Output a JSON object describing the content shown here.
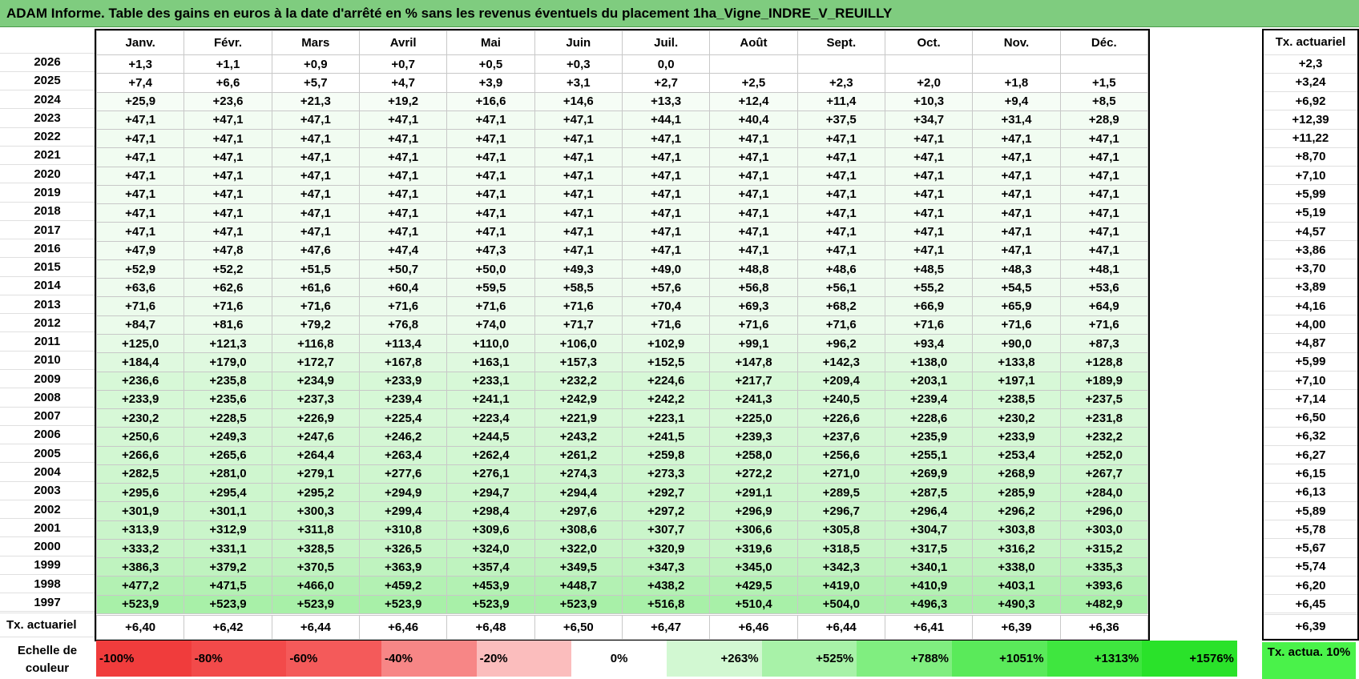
{
  "title": "ADAM Informe. Table des gains en euros à la date d'arrêté en % sans les revenus éventuels du placement 1ha_Vigne_INDRE_V_REUILLY",
  "months": [
    "Janv.",
    "Févr.",
    "Mars",
    "Avril",
    "Mai",
    "Juin",
    "Juil.",
    "Août",
    "Sept.",
    "Oct.",
    "Nov.",
    "Déc."
  ],
  "actuarial_header": "Tx. actuariel",
  "rows": [
    {
      "year": "2026",
      "values": [
        "+1,3",
        "+1,1",
        "+0,9",
        "+0,7",
        "+0,5",
        "+0,3",
        "0,0",
        "",
        "",
        "",
        "",
        ""
      ],
      "rate": "+2,3",
      "color": "#ffffff"
    },
    {
      "year": "2025",
      "values": [
        "+7,4",
        "+6,6",
        "+5,7",
        "+4,7",
        "+3,9",
        "+3,1",
        "+2,7",
        "+2,5",
        "+2,3",
        "+2,0",
        "+1,8",
        "+1,5"
      ],
      "rate": "+3,24",
      "color": "#ffffff"
    },
    {
      "year": "2024",
      "values": [
        "+25,9",
        "+23,6",
        "+21,3",
        "+19,2",
        "+16,6",
        "+14,6",
        "+13,3",
        "+12,4",
        "+11,4",
        "+10,3",
        "+9,4",
        "+8,5"
      ],
      "rate": "+6,92",
      "color": "#f6fdf6"
    },
    {
      "year": "2023",
      "values": [
        "+47,1",
        "+47,1",
        "+47,1",
        "+47,1",
        "+47,1",
        "+47,1",
        "+44,1",
        "+40,4",
        "+37,5",
        "+34,7",
        "+31,4",
        "+28,9"
      ],
      "rate": "+12,39",
      "color": "#f2fcf2"
    },
    {
      "year": "2022",
      "values": [
        "+47,1",
        "+47,1",
        "+47,1",
        "+47,1",
        "+47,1",
        "+47,1",
        "+47,1",
        "+47,1",
        "+47,1",
        "+47,1",
        "+47,1",
        "+47,1"
      ],
      "rate": "+11,22",
      "color": "#f1fcf1"
    },
    {
      "year": "2021",
      "values": [
        "+47,1",
        "+47,1",
        "+47,1",
        "+47,1",
        "+47,1",
        "+47,1",
        "+47,1",
        "+47,1",
        "+47,1",
        "+47,1",
        "+47,1",
        "+47,1"
      ],
      "rate": "+8,70",
      "color": "#f1fcf1"
    },
    {
      "year": "2020",
      "values": [
        "+47,1",
        "+47,1",
        "+47,1",
        "+47,1",
        "+47,1",
        "+47,1",
        "+47,1",
        "+47,1",
        "+47,1",
        "+47,1",
        "+47,1",
        "+47,1"
      ],
      "rate": "+7,10",
      "color": "#f1fcf1"
    },
    {
      "year": "2019",
      "values": [
        "+47,1",
        "+47,1",
        "+47,1",
        "+47,1",
        "+47,1",
        "+47,1",
        "+47,1",
        "+47,1",
        "+47,1",
        "+47,1",
        "+47,1",
        "+47,1"
      ],
      "rate": "+5,99",
      "color": "#f1fcf1"
    },
    {
      "year": "2018",
      "values": [
        "+47,1",
        "+47,1",
        "+47,1",
        "+47,1",
        "+47,1",
        "+47,1",
        "+47,1",
        "+47,1",
        "+47,1",
        "+47,1",
        "+47,1",
        "+47,1"
      ],
      "rate": "+5,19",
      "color": "#f1fcf1"
    },
    {
      "year": "2017",
      "values": [
        "+47,1",
        "+47,1",
        "+47,1",
        "+47,1",
        "+47,1",
        "+47,1",
        "+47,1",
        "+47,1",
        "+47,1",
        "+47,1",
        "+47,1",
        "+47,1"
      ],
      "rate": "+4,57",
      "color": "#f1fcf1"
    },
    {
      "year": "2016",
      "values": [
        "+47,9",
        "+47,8",
        "+47,6",
        "+47,4",
        "+47,3",
        "+47,1",
        "+47,1",
        "+47,1",
        "+47,1",
        "+47,1",
        "+47,1",
        "+47,1"
      ],
      "rate": "+3,86",
      "color": "#f1fcf1"
    },
    {
      "year": "2015",
      "values": [
        "+52,9",
        "+52,2",
        "+51,5",
        "+50,7",
        "+50,0",
        "+49,3",
        "+49,0",
        "+48,8",
        "+48,6",
        "+48,5",
        "+48,3",
        "+48,1"
      ],
      "rate": "+3,70",
      "color": "#f0fcf0"
    },
    {
      "year": "2014",
      "values": [
        "+63,6",
        "+62,6",
        "+61,6",
        "+60,4",
        "+59,5",
        "+58,5",
        "+57,6",
        "+56,8",
        "+56,1",
        "+55,2",
        "+54,5",
        "+53,6"
      ],
      "rate": "+3,89",
      "color": "#eefbee"
    },
    {
      "year": "2013",
      "values": [
        "+71,6",
        "+71,6",
        "+71,6",
        "+71,6",
        "+71,6",
        "+71,6",
        "+70,4",
        "+69,3",
        "+68,2",
        "+66,9",
        "+65,9",
        "+64,9"
      ],
      "rate": "+4,16",
      "color": "#ecfbec"
    },
    {
      "year": "2012",
      "values": [
        "+84,7",
        "+81,6",
        "+79,2",
        "+76,8",
        "+74,0",
        "+71,7",
        "+71,6",
        "+71,6",
        "+71,6",
        "+71,6",
        "+71,6",
        "+71,6"
      ],
      "rate": "+4,00",
      "color": "#ebfbeb"
    },
    {
      "year": "2011",
      "values": [
        "+125,0",
        "+121,3",
        "+116,8",
        "+113,4",
        "+110,0",
        "+106,0",
        "+102,9",
        "+99,1",
        "+96,2",
        "+93,4",
        "+90,0",
        "+87,3"
      ],
      "rate": "+4,87",
      "color": "#e6fae6"
    },
    {
      "year": "2010",
      "values": [
        "+184,4",
        "+179,0",
        "+172,7",
        "+167,8",
        "+163,1",
        "+157,3",
        "+152,5",
        "+147,8",
        "+142,3",
        "+138,0",
        "+133,8",
        "+128,8"
      ],
      "rate": "+5,99",
      "color": "#dff9df"
    },
    {
      "year": "2009",
      "values": [
        "+236,6",
        "+235,8",
        "+234,9",
        "+233,9",
        "+233,1",
        "+232,2",
        "+224,6",
        "+217,7",
        "+209,4",
        "+203,1",
        "+197,1",
        "+189,9"
      ],
      "rate": "+7,10",
      "color": "#d7f8d7"
    },
    {
      "year": "2008",
      "values": [
        "+233,9",
        "+235,6",
        "+237,3",
        "+239,4",
        "+241,1",
        "+242,9",
        "+242,2",
        "+241,3",
        "+240,5",
        "+239,4",
        "+238,5",
        "+237,5"
      ],
      "rate": "+7,14",
      "color": "#d6f8d6"
    },
    {
      "year": "2007",
      "values": [
        "+230,2",
        "+228,5",
        "+226,9",
        "+225,4",
        "+223,4",
        "+221,9",
        "+223,1",
        "+225,0",
        "+226,6",
        "+228,6",
        "+230,2",
        "+231,8"
      ],
      "rate": "+6,50",
      "color": "#d7f8d7"
    },
    {
      "year": "2006",
      "values": [
        "+250,6",
        "+249,3",
        "+247,6",
        "+246,2",
        "+244,5",
        "+243,2",
        "+241,5",
        "+239,3",
        "+237,6",
        "+235,9",
        "+233,9",
        "+232,2"
      ],
      "rate": "+6,32",
      "color": "#d4f7d4"
    },
    {
      "year": "2005",
      "values": [
        "+266,6",
        "+265,6",
        "+264,4",
        "+263,4",
        "+262,4",
        "+261,2",
        "+259,8",
        "+258,0",
        "+256,6",
        "+255,1",
        "+253,4",
        "+252,0"
      ],
      "rate": "+6,27",
      "color": "#d2f7d2"
    },
    {
      "year": "2004",
      "values": [
        "+282,5",
        "+281,0",
        "+279,1",
        "+277,6",
        "+276,1",
        "+274,3",
        "+273,3",
        "+272,2",
        "+271,0",
        "+269,9",
        "+268,9",
        "+267,7"
      ],
      "rate": "+6,15",
      "color": "#cff6cf"
    },
    {
      "year": "2003",
      "values": [
        "+295,6",
        "+295,4",
        "+295,2",
        "+294,9",
        "+294,7",
        "+294,4",
        "+292,7",
        "+291,1",
        "+289,5",
        "+287,5",
        "+285,9",
        "+284,0"
      ],
      "rate": "+6,13",
      "color": "#cdf6cd"
    },
    {
      "year": "2002",
      "values": [
        "+301,9",
        "+301,1",
        "+300,3",
        "+299,4",
        "+298,4",
        "+297,6",
        "+297,2",
        "+296,9",
        "+296,7",
        "+296,4",
        "+296,2",
        "+296,0"
      ],
      "rate": "+5,89",
      "color": "#ccf6cc"
    },
    {
      "year": "2001",
      "values": [
        "+313,9",
        "+312,9",
        "+311,8",
        "+310,8",
        "+309,6",
        "+308,6",
        "+307,7",
        "+306,6",
        "+305,8",
        "+304,7",
        "+303,8",
        "+303,0"
      ],
      "rate": "+5,78",
      "color": "#caf5ca"
    },
    {
      "year": "2000",
      "values": [
        "+333,2",
        "+331,1",
        "+328,5",
        "+326,5",
        "+324,0",
        "+322,0",
        "+320,9",
        "+319,6",
        "+318,5",
        "+317,5",
        "+316,2",
        "+315,2"
      ],
      "rate": "+5,67",
      "color": "#c7f5c7"
    },
    {
      "year": "1999",
      "values": [
        "+386,3",
        "+379,2",
        "+370,5",
        "+363,9",
        "+357,4",
        "+349,5",
        "+347,3",
        "+345,0",
        "+342,3",
        "+340,1",
        "+338,0",
        "+335,3"
      ],
      "rate": "+5,74",
      "color": "#bff3bf"
    },
    {
      "year": "1998",
      "values": [
        "+477,2",
        "+471,5",
        "+466,0",
        "+459,2",
        "+453,9",
        "+448,7",
        "+438,2",
        "+429,5",
        "+419,0",
        "+410,9",
        "+403,1",
        "+393,6"
      ],
      "rate": "+6,20",
      "color": "#b3f1b3"
    },
    {
      "year": "1997",
      "values": [
        "+523,9",
        "+523,9",
        "+523,9",
        "+523,9",
        "+523,9",
        "+523,9",
        "+516,8",
        "+510,4",
        "+504,0",
        "+496,3",
        "+490,3",
        "+482,9"
      ],
      "rate": "+6,45",
      "color": "#a8f0a8"
    }
  ],
  "footer": {
    "label": "Tx. actuariel",
    "values": [
      "+6,40",
      "+6,42",
      "+6,44",
      "+6,46",
      "+6,48",
      "+6,50",
      "+6,47",
      "+6,46",
      "+6,44",
      "+6,41",
      "+6,39",
      "+6,36"
    ],
    "rate": "+6,39"
  },
  "legend": {
    "label": "Echelle de couleur",
    "cells": [
      {
        "text": "-100%",
        "color": "#f03c3c",
        "kind": "neg"
      },
      {
        "text": "-80%",
        "color": "#f24a4a",
        "kind": "neg"
      },
      {
        "text": "-60%",
        "color": "#f45a5a",
        "kind": "neg"
      },
      {
        "text": "-40%",
        "color": "#f78686",
        "kind": "neg"
      },
      {
        "text": "-20%",
        "color": "#fbbdbd",
        "kind": "neg"
      },
      {
        "text": "0%",
        "color": "#ffffff",
        "kind": "zero"
      },
      {
        "text": "+263%",
        "color": "#d2f8d2",
        "kind": "pos"
      },
      {
        "text": "+525%",
        "color": "#a8f2a8",
        "kind": "pos"
      },
      {
        "text": "+788%",
        "color": "#80ee80",
        "kind": "pos"
      },
      {
        "text": "+1051%",
        "color": "#5aea5a",
        "kind": "pos"
      },
      {
        "text": "+1313%",
        "color": "#3fe63f",
        "kind": "pos"
      },
      {
        "text": "+1576%",
        "color": "#2ae22a",
        "kind": "pos"
      }
    ],
    "actuarial_label": "Tx. actua. 10%",
    "actuarial_color": "#4af24a"
  }
}
